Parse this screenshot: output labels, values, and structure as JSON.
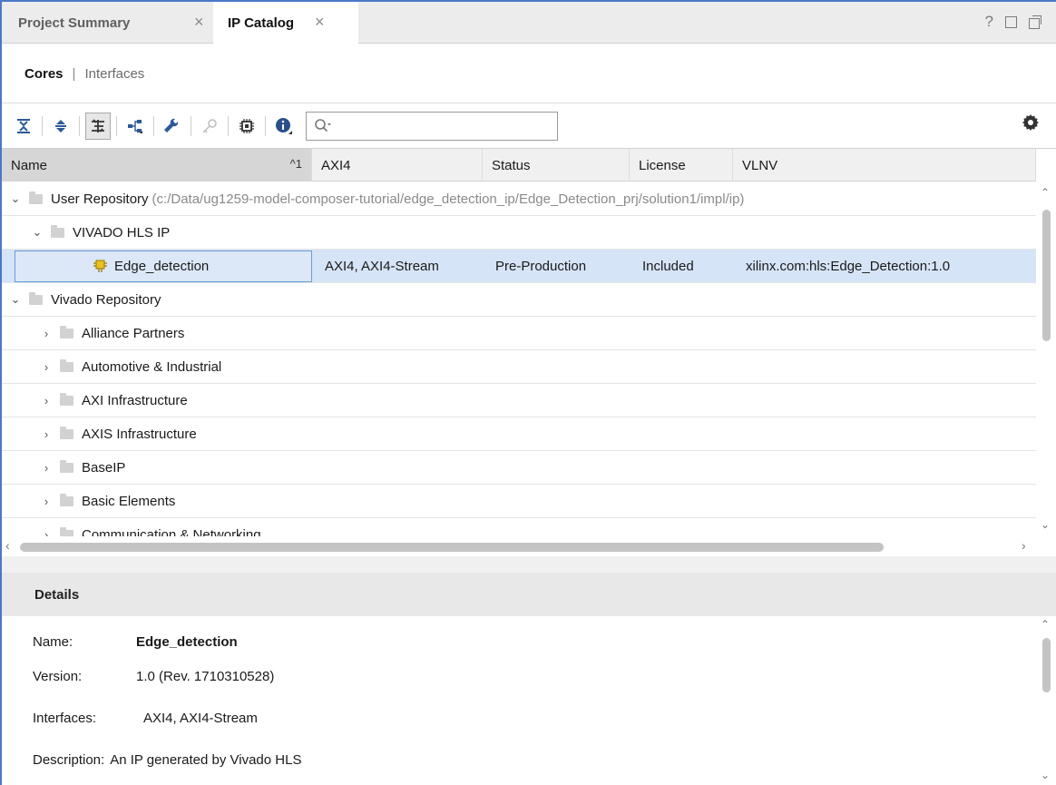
{
  "tabs": [
    {
      "label": "Project Summary"
    },
    {
      "label": "IP Catalog"
    }
  ],
  "window_buttons": {
    "help": "?"
  },
  "subtabs": {
    "cores": "Cores",
    "separator": "|",
    "interfaces": "Interfaces"
  },
  "search": {
    "value": "",
    "placeholder": ""
  },
  "columns": {
    "name": "Name",
    "sort_indicator": "^1",
    "axi4": "AXI4",
    "status": "Status",
    "license": "License",
    "vlnv": "VLNV"
  },
  "tree": {
    "user_repo": {
      "label": "User Repository",
      "path": "(c:/Data/ug1259-model-composer-tutorial/edge_detection_ip/Edge_Detection_prj/solution1/impl/ip)"
    },
    "vivado_hls": {
      "label": "VIVADO HLS IP"
    },
    "selected_ip": {
      "name": "Edge_detection",
      "axi4": "AXI4, AXI4-Stream",
      "status": "Pre-Production",
      "license": "Included",
      "vlnv": "xilinx.com:hls:Edge_Detection:1.0"
    },
    "vivado_repo": {
      "label": "Vivado Repository"
    },
    "categories": [
      "Alliance Partners",
      "Automotive & Industrial",
      "AXI Infrastructure",
      "AXIS Infrastructure",
      "BaseIP",
      "Basic Elements",
      "Communication & Networking"
    ]
  },
  "details": {
    "header": "Details",
    "name_label": "Name:",
    "name_value": "Edge_detection",
    "version_label": "Version:",
    "version_value": "1.0 (Rev. 1710310528)",
    "interfaces_label": "Interfaces:",
    "interfaces_value": "AXI4, AXI4-Stream",
    "description_label": "Description:",
    "description_value": "An IP generated by Vivado HLS"
  },
  "colors": {
    "accent": "#4a78c8",
    "selection": "#d6e4f7",
    "sorted_header": "#d6d6d6"
  }
}
